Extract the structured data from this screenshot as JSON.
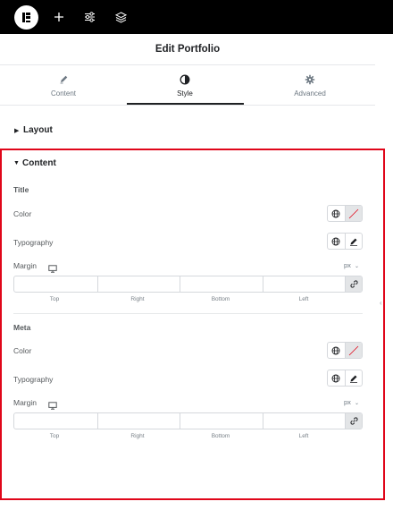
{
  "topbar": {
    "logo_icon": "elementor-logo-icon",
    "add_icon": "plus-icon",
    "settings_icon": "sliders-icon",
    "navigator_icon": "layers-icon"
  },
  "header": {
    "title": "Edit Portfolio"
  },
  "tabs": [
    {
      "label": "Content",
      "icon": "pencil-icon",
      "active": false
    },
    {
      "label": "Style",
      "icon": "contrast-icon",
      "active": true
    },
    {
      "label": "Advanced",
      "icon": "gear-icon",
      "active": false
    }
  ],
  "sections": {
    "layout": {
      "title": "Layout",
      "expanded": false
    },
    "content": {
      "title": "Content",
      "expanded": true
    }
  },
  "title_group": {
    "heading": "Title",
    "color_label": "Color",
    "typography_label": "Typography",
    "margin_label": "Margin",
    "unit": "px",
    "dims": [
      "Top",
      "Right",
      "Bottom",
      "Left"
    ]
  },
  "meta_group": {
    "heading": "Meta",
    "color_label": "Color",
    "typography_label": "Typography",
    "margin_label": "Margin",
    "unit": "px",
    "dims": [
      "Top",
      "Right",
      "Bottom",
      "Left"
    ]
  },
  "colors": {
    "topbar": "#000000",
    "highlight_border": "#e0061a",
    "active_tab_underline": "#1f2124"
  }
}
